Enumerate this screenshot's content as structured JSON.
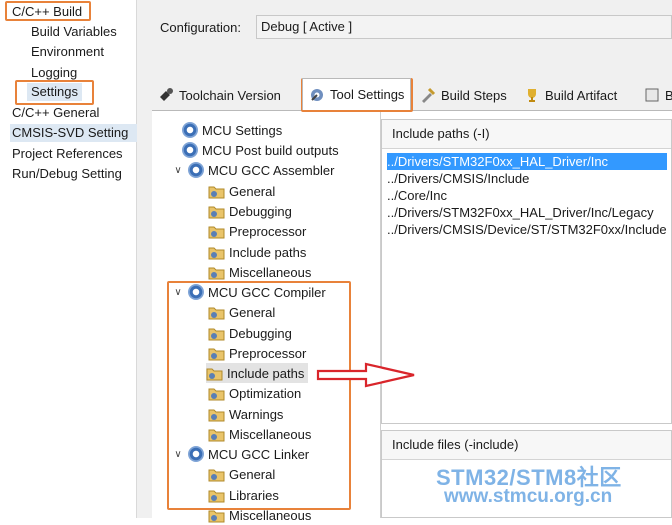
{
  "nav": {
    "items": [
      {
        "label": "C/C++ Build"
      },
      {
        "label": "Build Variables"
      },
      {
        "label": "Environment"
      },
      {
        "label": "Logging"
      },
      {
        "label": "Settings"
      },
      {
        "label": "C/C++ General"
      },
      {
        "label": "CMSIS-SVD Setting"
      },
      {
        "label": "Project References"
      },
      {
        "label": "Run/Debug Setting"
      }
    ]
  },
  "config": {
    "label": "Configuration:",
    "value": "Debug  [ Active ]"
  },
  "tabs": [
    {
      "label": "Toolchain  Version",
      "icon": "toolchain-icon"
    },
    {
      "label": "Tool Settings",
      "icon": "tool-settings-icon"
    },
    {
      "label": "Build Steps",
      "icon": "build-steps-icon"
    },
    {
      "label": "Build Artifact",
      "icon": "trophy-icon"
    },
    {
      "label": "B",
      "icon": "binary-icon"
    }
  ],
  "tree": [
    {
      "label": "MCU Settings",
      "icon": "gear"
    },
    {
      "label": "MCU Post build outputs",
      "icon": "gear"
    },
    {
      "label": "MCU GCC Assembler",
      "icon": "gear"
    },
    {
      "label": "General",
      "icon": "folder"
    },
    {
      "label": "Debugging",
      "icon": "folder"
    },
    {
      "label": "Preprocessor",
      "icon": "folder"
    },
    {
      "label": "Include paths",
      "icon": "folder"
    },
    {
      "label": "Miscellaneous",
      "icon": "folder"
    },
    {
      "label": "MCU GCC Compiler",
      "icon": "gear"
    },
    {
      "label": "General",
      "icon": "folder"
    },
    {
      "label": "Debugging",
      "icon": "folder"
    },
    {
      "label": "Preprocessor",
      "icon": "folder"
    },
    {
      "label": "Include paths",
      "icon": "folder"
    },
    {
      "label": "Optimization",
      "icon": "folder"
    },
    {
      "label": "Warnings",
      "icon": "folder"
    },
    {
      "label": "Miscellaneous",
      "icon": "folder"
    },
    {
      "label": "MCU GCC Linker",
      "icon": "gear"
    },
    {
      "label": "General",
      "icon": "folder"
    },
    {
      "label": "Libraries",
      "icon": "folder"
    },
    {
      "label": "Miscellaneous",
      "icon": "folder"
    }
  ],
  "include_paths": {
    "title": "Include paths (-I)",
    "items": [
      "../Drivers/STM32F0xx_HAL_Driver/Inc",
      "../Drivers/CMSIS/Include",
      "../Core/Inc",
      "../Drivers/STM32F0xx_HAL_Driver/Inc/Legacy",
      "../Drivers/CMSIS/Device/ST/STM32F0xx/Include"
    ]
  },
  "include_files": {
    "title": "Include files (-include)"
  },
  "watermark": {
    "line1": "STM32/STM8社区",
    "line2": "www.stmcu.org.cn"
  },
  "colors": {
    "annotation": "#e8823a",
    "selection": "#3399ff",
    "watermark": "#7fb3e6"
  }
}
